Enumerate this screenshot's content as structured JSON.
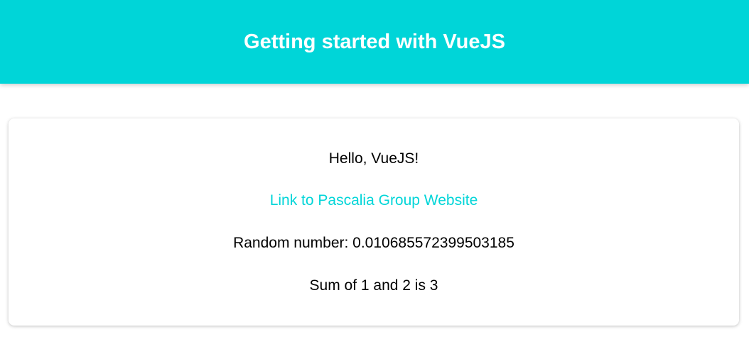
{
  "header": {
    "title": "Getting started with VueJS"
  },
  "main": {
    "greeting": "Hello, VueJS!",
    "link_label": "Link to Pascalia Group Website",
    "random_text": "Random number: 0.010685572399503185",
    "sum_text": "Sum of 1 and 2 is 3"
  },
  "colors": {
    "accent": "#00d5d8"
  }
}
